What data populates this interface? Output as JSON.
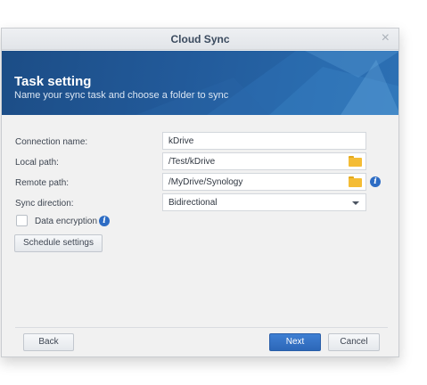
{
  "window": {
    "title": "Cloud Sync",
    "close_glyph": "×"
  },
  "banner": {
    "heading": "Task setting",
    "subheading": "Name your sync task and choose a folder to sync"
  },
  "form": {
    "connection_name": {
      "label": "Connection name:",
      "value": "kDrive"
    },
    "local_path": {
      "label": "Local path:",
      "value": "/Test/kDrive",
      "icon": "folder-icon"
    },
    "remote_path": {
      "label": "Remote path:",
      "value": "/MyDrive/Synology",
      "icon": "folder-icon"
    },
    "sync_direction": {
      "label": "Sync direction:",
      "value": "Bidirectional"
    },
    "data_encryption": {
      "label": "Data encryption",
      "checked": false,
      "icon": "info-icon"
    },
    "schedule_button": "Schedule settings"
  },
  "footer": {
    "back": "Back",
    "next": "Next",
    "cancel": "Cancel"
  },
  "colors": {
    "banner": "#225a9a",
    "primary_button": "#2c67b8",
    "info_icon": "#2d6cc4",
    "folder": "#f4bc35"
  }
}
